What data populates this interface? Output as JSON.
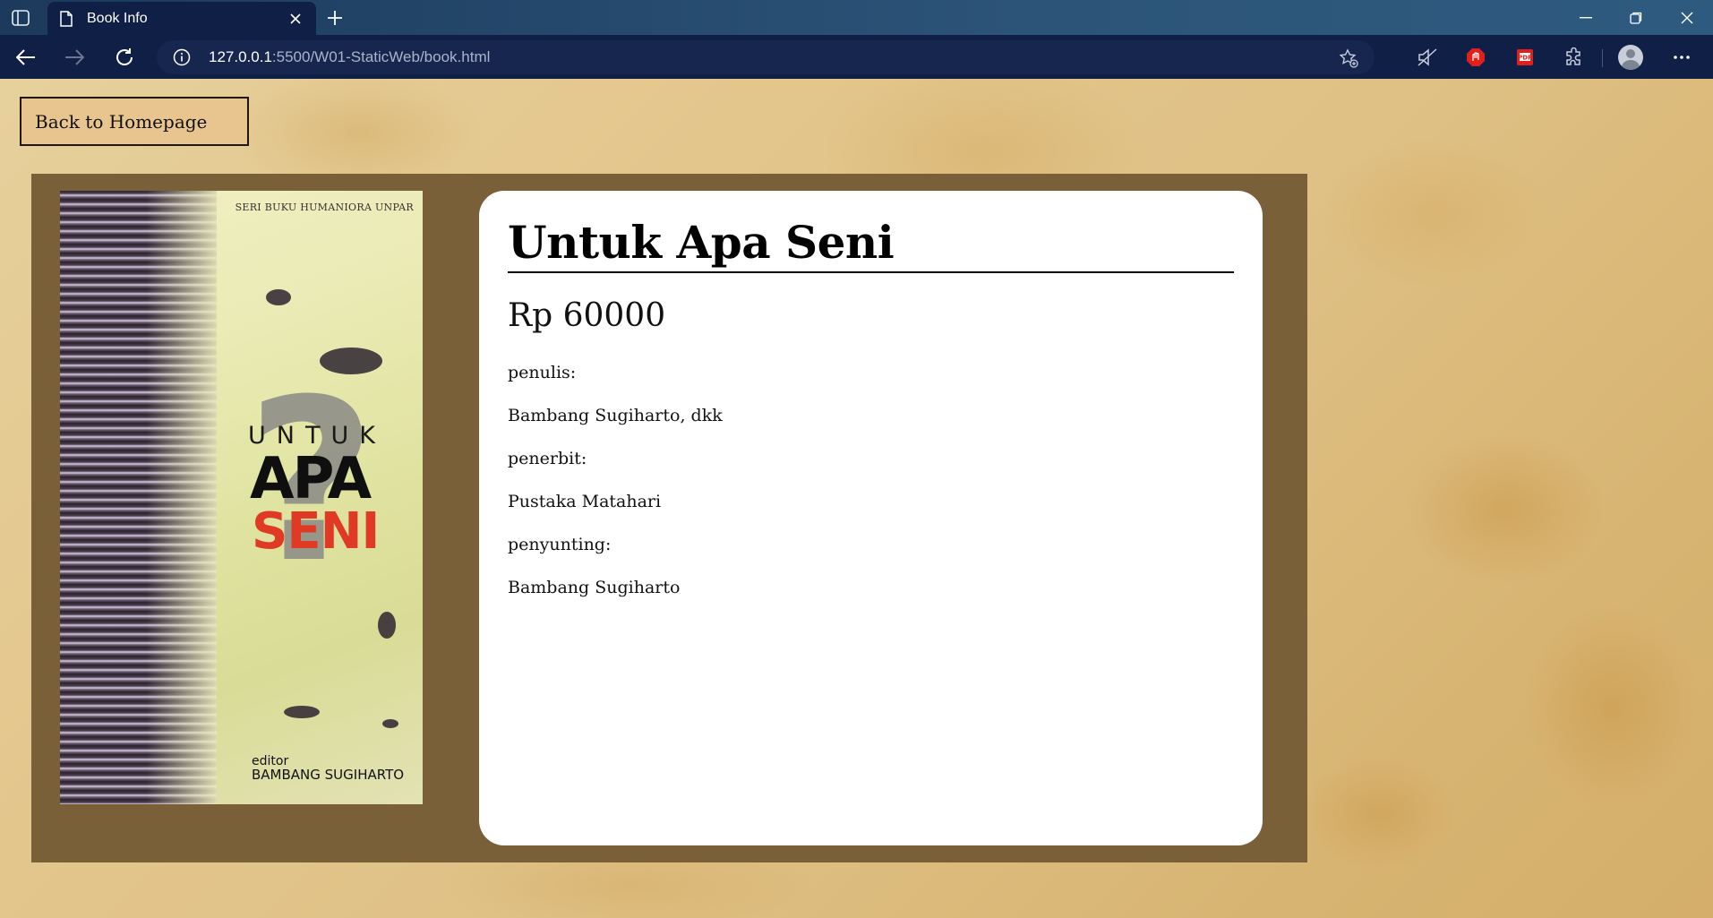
{
  "browser": {
    "tab_title": "Book Info",
    "url_host": "127.0.0.1",
    "url_rest": ":5500/W01-StaticWeb/book.html"
  },
  "page": {
    "back_button": "Back to Homepage",
    "cover": {
      "series": "SERI BUKU HUMANIORA UNPAR",
      "title_top": "UNTUK",
      "title_mid": "APA",
      "title_bottom": "SENI",
      "editor_label": "editor",
      "editor_name": "BAMBANG SUGIHARTO"
    },
    "book": {
      "title": "Untuk Apa Seni",
      "price": "Rp 60000",
      "author_label": "penulis:",
      "author": "Bambang Sugiharto, dkk",
      "publisher_label": "penerbit:",
      "publisher": "Pustaka Matahari",
      "editor_label": "penyunting:",
      "editor": "Bambang Sugiharto"
    }
  },
  "colors": {
    "panel": "#7a6038",
    "button": "#e8c48e",
    "chrome_dark": "#0f1f45",
    "cover_red": "#e03a25"
  },
  "icons": [
    "tab-actions-icon",
    "page-icon",
    "close-icon",
    "plus-icon",
    "minimize-icon",
    "restore-icon",
    "back-arrow-icon",
    "forward-arrow-icon",
    "refresh-icon",
    "info-icon",
    "add-favorite-icon",
    "read-aloud-icon",
    "adblock-icon",
    "pdf-extension-icon",
    "extensions-icon",
    "profile-avatar",
    "more-icon"
  ]
}
